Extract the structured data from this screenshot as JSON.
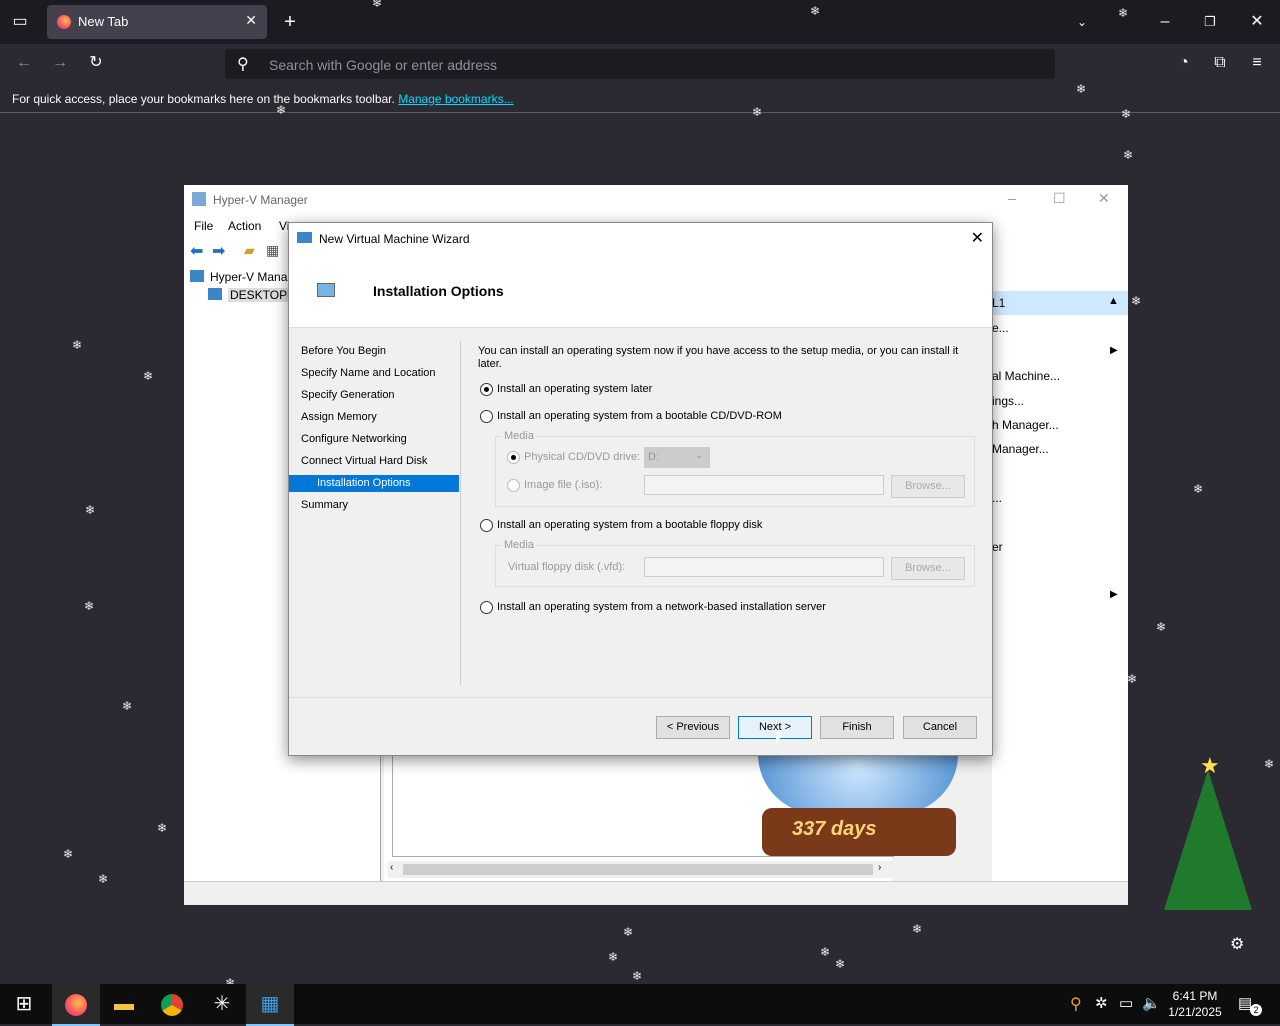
{
  "browser": {
    "tab_title": "New Tab",
    "search_placeholder": "Search with Google or enter address",
    "bookmarks_msg": "For quick access, place your bookmarks here on the bookmarks toolbar.",
    "bookmarks_link": "Manage bookmarks..."
  },
  "hyperv": {
    "title": "Hyper-V Manager",
    "menu": [
      "File",
      "Action",
      "Vi"
    ],
    "tree": [
      "Hyper-V Mana",
      "DESKTOP-L"
    ],
    "actions_header": "L1",
    "actions": [
      "e...",
      "al Machine...",
      "ings...",
      "h Manager...",
      "Manager...",
      "...",
      "er"
    ]
  },
  "wizard": {
    "title": "New Virtual Machine Wizard",
    "heading": "Installation Options",
    "steps": [
      "Before You Begin",
      "Specify Name and Location",
      "Specify Generation",
      "Assign Memory",
      "Configure Networking",
      "Connect Virtual Hard Disk",
      "Installation Options",
      "Summary"
    ],
    "selected_step": "Installation Options",
    "intro": "You can install an operating system now if you have access to the setup media, or you can install it later.",
    "opt_later": "Install an operating system later",
    "opt_cd": "Install an operating system from a bootable CD/DVD-ROM",
    "media_label": "Media",
    "physical_cd": "Physical CD/DVD drive:",
    "drive_value": "D:",
    "image_file": "Image file (.iso):",
    "browse": "Browse...",
    "opt_floppy": "Install an operating system from a bootable floppy disk",
    "media_label2": "Media",
    "vfd": "Virtual floppy disk (.vfd):",
    "browse2": "Browse...",
    "opt_network": "Install an operating system from a network-based installation server",
    "btn_previous": "< Previous",
    "btn_next": "Next >",
    "btn_finish": "Finish",
    "btn_cancel": "Cancel"
  },
  "widget": {
    "countdown": "337 days"
  },
  "taskbar": {
    "time": "6:41 PM",
    "date": "1/21/2025",
    "notif_count": "2"
  }
}
